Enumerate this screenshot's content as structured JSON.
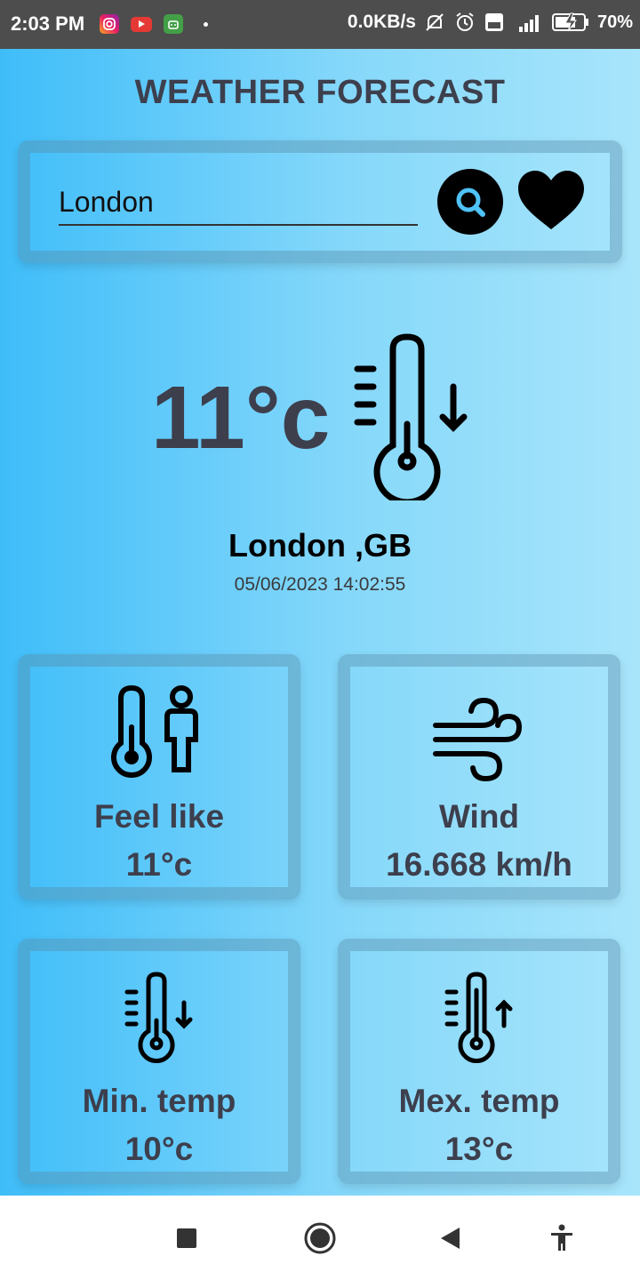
{
  "status_bar": {
    "time": "2:03 PM",
    "net_speed": "0.0KB/s",
    "battery": "70%",
    "icons": [
      "instagram-icon",
      "youtube-icon",
      "android-app-icon",
      "notification-dot",
      "mute-icon",
      "alarm-icon",
      "volte-icon",
      "signal-icon",
      "battery-charging-icon"
    ]
  },
  "app": {
    "title": "WEATHER FORECAST",
    "search": {
      "value": "London",
      "icon": "search-icon",
      "favorite_icon": "heart-icon"
    },
    "current": {
      "temperature": "11°c",
      "icon": "thermometer-down-icon",
      "location": "London ,GB",
      "datetime": "05/06/2023 14:02:55"
    },
    "cards": [
      {
        "label": "Feel like",
        "value": "11°c",
        "icon": "thermometer-person-icon"
      },
      {
        "label": "Wind",
        "value": "16.668 km/h",
        "icon": "wind-icon"
      },
      {
        "label": "Min. temp",
        "value": "10°c",
        "icon": "thermometer-down-icon"
      },
      {
        "label": "Mex. temp",
        "value": "13°c",
        "icon": "thermometer-up-icon"
      }
    ]
  },
  "nav_bar": {
    "buttons": [
      "recents-square-icon",
      "home-circle-icon",
      "back-triangle-icon",
      "accessibility-icon"
    ]
  },
  "colors": {
    "background_start": "#3fbdf9",
    "background_end": "#a8e5fb",
    "text_dark": "#3d3f4d",
    "status_bar": "#4d4d4d"
  }
}
